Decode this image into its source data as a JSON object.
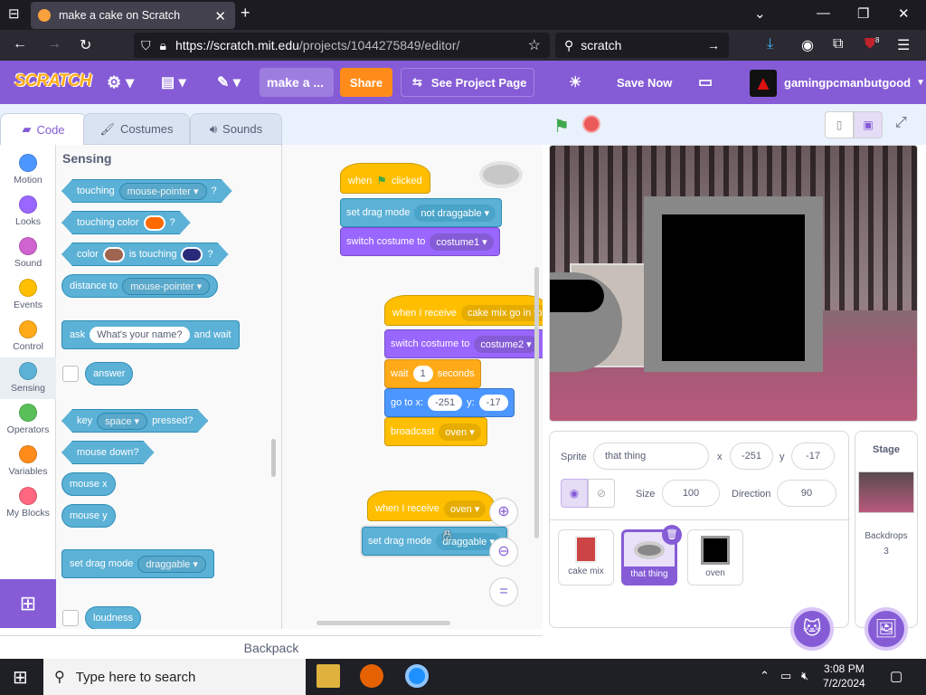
{
  "browser": {
    "tab_title": "make a cake on Scratch",
    "url_prefix": "https://scratch.",
    "url_domain": "mit.edu",
    "url_path": "/projects/1044275849/editor/",
    "search_text": "scratch",
    "badge_count": "8"
  },
  "menubar": {
    "logo": "SCRATCH",
    "project_title": "make a ...",
    "share": "Share",
    "see_project": "See Project Page",
    "save_now": "Save Now",
    "username": "gamingpcmanbutgood"
  },
  "tabs": {
    "code": "Code",
    "costumes": "Costumes",
    "sounds": "Sounds"
  },
  "categories": [
    {
      "label": "Motion",
      "color": "#4c97ff"
    },
    {
      "label": "Looks",
      "color": "#9966ff"
    },
    {
      "label": "Sound",
      "color": "#cf63cf"
    },
    {
      "label": "Events",
      "color": "#ffbf00"
    },
    {
      "label": "Control",
      "color": "#ffab19"
    },
    {
      "label": "Sensing",
      "color": "#5cb1d6"
    },
    {
      "label": "Operators",
      "color": "#59c059"
    },
    {
      "label": "Variables",
      "color": "#ff8c1a"
    },
    {
      "label": "My Blocks",
      "color": "#ff6680"
    }
  ],
  "palette": {
    "title": "Sensing",
    "touching": "touching",
    "mouse_pointer": "mouse-pointer",
    "q": "?",
    "touching_color": "touching color",
    "color": "color",
    "is_touching": "is touching",
    "distance_to": "distance to",
    "ask": "ask",
    "ask_default": "What's your name?",
    "and_wait": "and wait",
    "answer": "answer",
    "key": "key",
    "space": "space",
    "pressed": "pressed?",
    "mouse_down": "mouse down?",
    "mouse_x": "mouse x",
    "mouse_y": "mouse y",
    "set_drag_mode": "set drag mode",
    "draggable": "draggable",
    "loudness": "loudness",
    "swatch_orange": "#ff6a00",
    "swatch_brown": "#a0654f",
    "swatch_navy": "#2a2a7a"
  },
  "scripts": {
    "s1": {
      "when": "when",
      "clicked": "clicked",
      "set_drag_mode": "set drag mode",
      "not_draggable": "not draggable",
      "switch_costume": "switch costume to",
      "costume1": "costume1"
    },
    "s2": {
      "when_i_receive": "when I receive",
      "msg": "cake mix go in to",
      "switch_costume": "switch costume to",
      "costume2": "costume2",
      "wait": "wait",
      "wait_val": "1",
      "seconds": "seconds",
      "go_to_x": "go to x:",
      "x_val": "-251",
      "y": "y:",
      "y_val": "-17",
      "broadcast": "broadcast",
      "oven": "oven"
    },
    "s3": {
      "when_i_receive": "when I receive",
      "oven": "oven",
      "set_drag_mode": "set drag mode",
      "draggable": "draggable"
    },
    "zoom_reset": "="
  },
  "backpack": "Backpack",
  "sprite_info": {
    "sprite_label": "Sprite",
    "sprite_name": "that thing",
    "x_label": "x",
    "x_val": "-251",
    "y_label": "y",
    "y_val": "-17",
    "size_label": "Size",
    "size_val": "100",
    "direction_label": "Direction",
    "direction_val": "90"
  },
  "sprites": [
    {
      "name": "cake mix"
    },
    {
      "name": "that thing"
    },
    {
      "name": "oven"
    }
  ],
  "stage_panel": {
    "title": "Stage",
    "backdrops_label": "Backdrops",
    "backdrops_count": "3"
  },
  "taskbar": {
    "search_placeholder": "Type here to search",
    "time": "3:08 PM",
    "date": "7/2/2024"
  }
}
